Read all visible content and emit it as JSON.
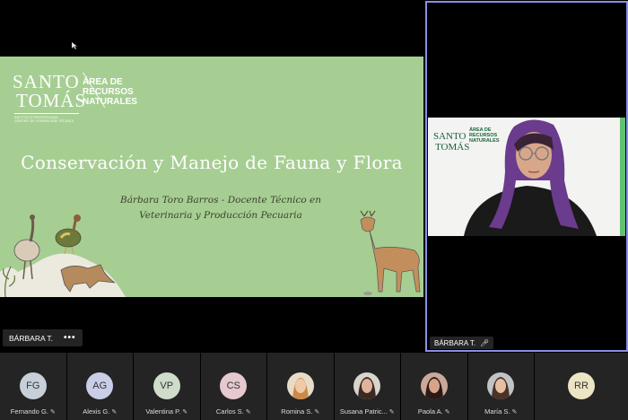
{
  "shared_screen": {
    "slide": {
      "logo_top": "SANTO",
      "logo_bottom": "TOMÁS",
      "logo_sub_1": "INSTITUTO PROFESIONAL",
      "logo_sub_2": "CENTRO DE FORMACIÓN TÉCNICA",
      "area_line_1": "ÁREA DE",
      "area_line_2": "RECURSOS",
      "area_line_3": "NATURALES",
      "title": "Conservación y Manejo de Fauna y Flora",
      "author_line_1": "Bárbara Toro Barros - Docente Técnico en",
      "author_line_2": "Veterinaria y Producción Pecuaria",
      "bg_color": "#a6ce92"
    },
    "presenter_label": "BÁRBARA T.",
    "more_label": "•••"
  },
  "speaker": {
    "name_label": "BÁRBARA T.",
    "mic_icon": "mic-icon",
    "border_color": "#8a8fe8",
    "bg_logo_top": "SANTO",
    "bg_logo_bottom": "TOMÁS",
    "bg_area_line_1": "ÁREA DE",
    "bg_area_line_2": "RECURSOS",
    "bg_area_line_3": "NATURALES"
  },
  "participants": [
    {
      "initials": "FG",
      "name": "Fernando G.",
      "color": "#c7d0d9"
    },
    {
      "initials": "AG",
      "name": "Alexis G.",
      "color": "#c9cde8"
    },
    {
      "initials": "VP",
      "name": "Valentina P.",
      "color": "#cfdccc"
    },
    {
      "initials": "CS",
      "name": "Carlos S.",
      "color": "#e6c8cf"
    },
    {
      "initials": "",
      "name": "Romina S.",
      "photo": true
    },
    {
      "initials": "",
      "name": "Susana Patric...",
      "photo": true
    },
    {
      "initials": "",
      "name": "Paola A.",
      "photo": true
    },
    {
      "initials": "",
      "name": "María S.",
      "photo": true
    },
    {
      "initials": "RR",
      "name": "",
      "color": "#ece5c3"
    }
  ]
}
